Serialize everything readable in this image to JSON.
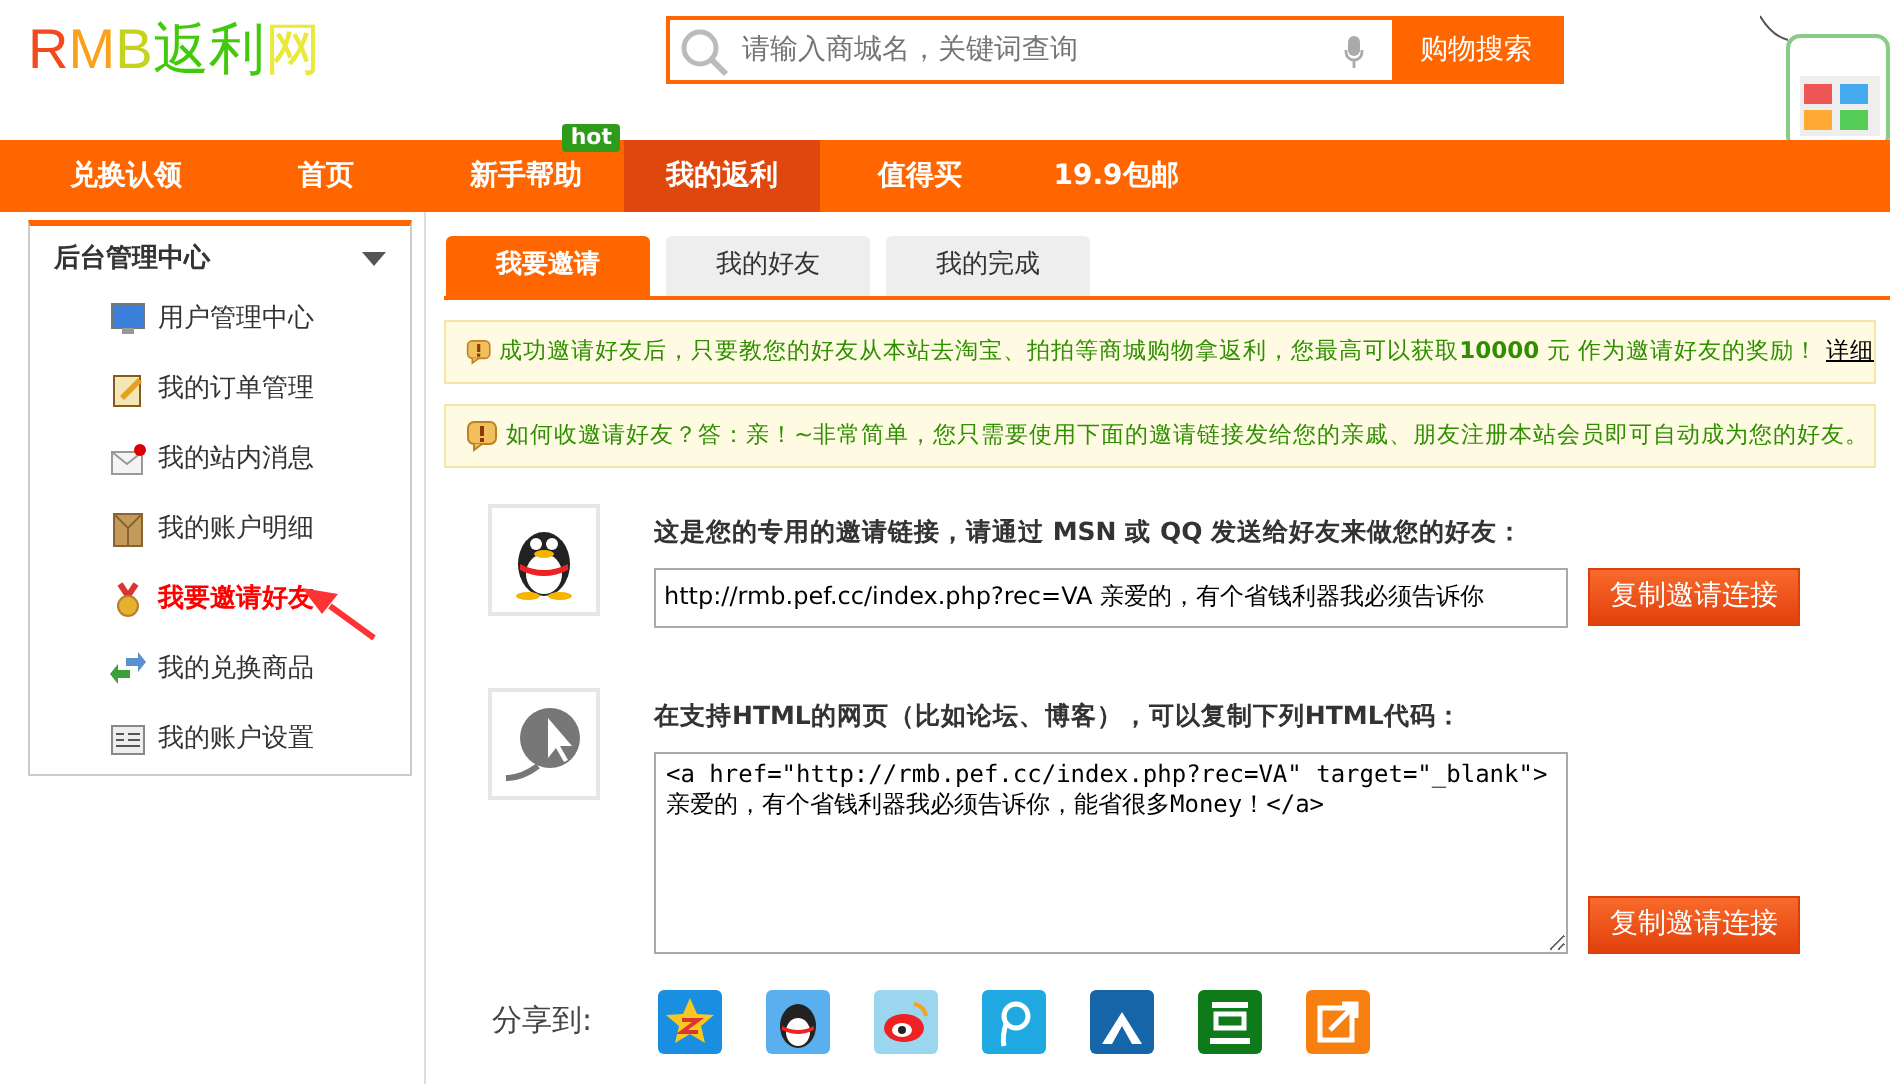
{
  "logo": {
    "text": "RMB返利网"
  },
  "search": {
    "placeholder": "请输入商城名，关键词查询",
    "button": "购物搜索"
  },
  "nav": [
    {
      "label": "兑换认领",
      "selected": false
    },
    {
      "label": "首页",
      "selected": false
    },
    {
      "label": "新手帮助",
      "selected": false,
      "badge": "hot"
    },
    {
      "label": "我的返利",
      "selected": true
    },
    {
      "label": "值得买",
      "selected": false
    },
    {
      "label": "19.9包邮",
      "selected": false
    }
  ],
  "sidebar": {
    "title": "后台管理中心",
    "items": [
      {
        "label": "用户管理中心",
        "kind": "monitor",
        "selected": false
      },
      {
        "label": "我的订单管理",
        "kind": "notepad",
        "selected": false
      },
      {
        "label": "我的站内消息",
        "kind": "mail",
        "selected": false
      },
      {
        "label": "我的账户明细",
        "kind": "box",
        "selected": false
      },
      {
        "label": "我要邀请好友",
        "kind": "medal",
        "selected": true
      },
      {
        "label": "我的兑换商品",
        "kind": "arrows",
        "selected": false
      },
      {
        "label": "我的账户设置",
        "kind": "panel",
        "selected": false
      }
    ]
  },
  "tabs": [
    {
      "label": "我要邀请",
      "selected": true
    },
    {
      "label": "我的好友",
      "selected": false
    },
    {
      "label": "我的完成",
      "selected": false
    }
  ],
  "notices": [
    {
      "text": "成功邀请好友后，只要教您的好友从本站去淘宝、拍拍等商城购物拿返利，您最高可以获取**10000** 元 作为邀请好友的奖励！",
      "link": "详细"
    },
    {
      "text": "如何收邀请好友？答：亲！~非常简单，您只需要使用下面的邀请链接发给您的亲戚、朋友注册本站会员即可自动成为您的好友。"
    }
  ],
  "invites": [
    {
      "kind": "link",
      "label": "这是您的专用的邀请链接，请通过 MSN 或 QQ 发送给好友来做您的好友：",
      "value": "http://rmb.pef.cc/index.php?rec=VA 亲爱的，有个省钱利器我必须告诉你",
      "button": "复制邀请连接"
    },
    {
      "kind": "code",
      "label": "在支持HTML的网页（比如论坛、博客），可以复制下列HTML代码：",
      "value": "<a href=\"http://rmb.pef.cc/index.php?rec=VA\" target=\"_blank\">亲爱的，有个省钱利器我必须告诉你，能省很多Money！</a>",
      "button": "复制邀请连接"
    }
  ],
  "share": {
    "label": "分享到:",
    "targets": [
      {
        "kind": "star"
      },
      {
        "kind": "penguin"
      },
      {
        "kind": "eye"
      },
      {
        "kind": "loop"
      },
      {
        "kind": "person"
      },
      {
        "kind": "bean"
      },
      {
        "kind": "frame"
      }
    ]
  }
}
